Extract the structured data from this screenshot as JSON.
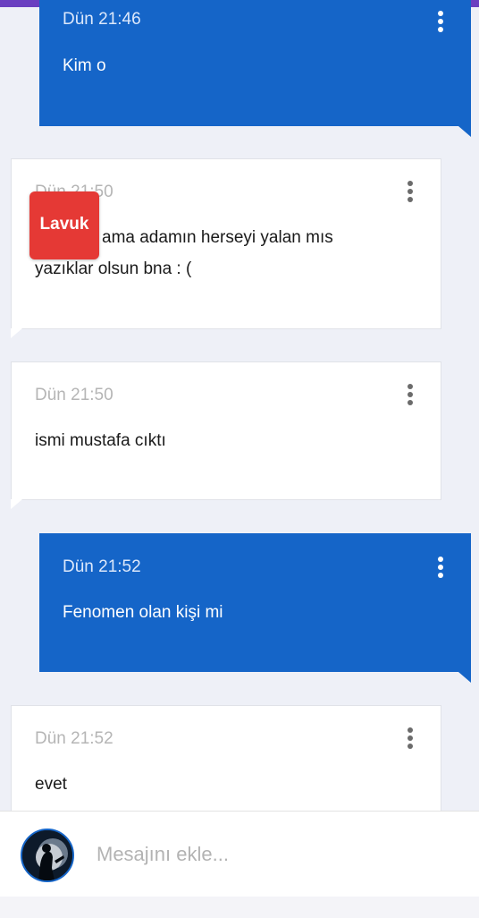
{
  "badge": {
    "label": "Lavuk",
    "color": "#e53935"
  },
  "colors": {
    "accent_bar": "#6a3fc0",
    "sent_bubble": "#1565c8",
    "received_bubble": "#ffffff"
  },
  "messages": [
    {
      "direction": "sent",
      "time": "Dün 21:46",
      "lines": [
        "Kim o"
      ]
    },
    {
      "direction": "received",
      "time": "Dün 21:50",
      "lines": [
        "ama adamın herseyi yalan mıs",
        "yazıklar olsun bna : ("
      ]
    },
    {
      "direction": "received",
      "time": "Dün 21:50",
      "lines": [
        "ismi mustafa cıktı"
      ]
    },
    {
      "direction": "sent",
      "time": "Dün 21:52",
      "lines": [
        "Fenomen olan kişi mi"
      ]
    },
    {
      "direction": "received",
      "time": "Dün 21:52",
      "lines": [
        "evet"
      ]
    }
  ],
  "composer": {
    "placeholder": "Mesajını ekle...",
    "value": ""
  },
  "icons": {
    "more": "more-vertical-icon",
    "avatar": "user-avatar"
  }
}
